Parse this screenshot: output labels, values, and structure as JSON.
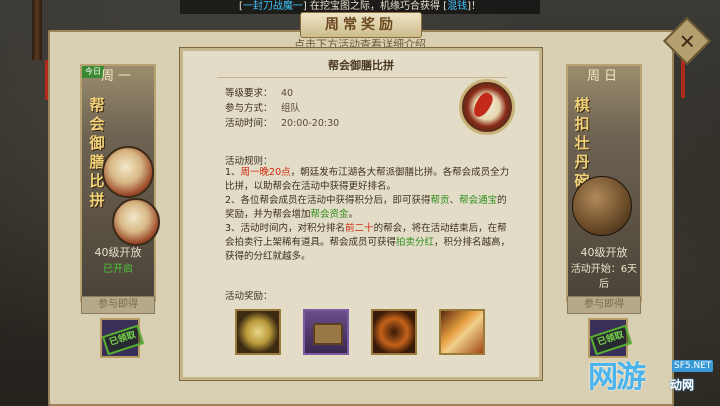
{
  "ticker": {
    "prefix": "[",
    "highlight1": "一封刀战魔一",
    "mid": "] 在挖宝图之际，机缘巧合获得 [",
    "highlight2": "混钱",
    "suffix": "]！"
  },
  "window_title": "周常奖励",
  "main_subtitle": "点击下方活动查看详细介绍",
  "close_icon": "close-icon",
  "cards": {
    "left": {
      "day": "周一",
      "today_tag": "今日",
      "name": "帮会御膳比拼",
      "level": "40级开放",
      "status": "已开启",
      "join": "参与即得",
      "stamp": "已领取"
    },
    "right": {
      "day": "周日",
      "name": "棋扣壮丹碗",
      "level": "40级开放",
      "status": "活动开始：6天后",
      "join": "参与即得",
      "stamp": "已领取"
    }
  },
  "popup": {
    "title": "帮会御膳比拼",
    "level_label": "等级要求：",
    "level_value": "40",
    "mode_label": "参与方式：",
    "mode_value": "组队",
    "time_label": "活动时间：",
    "time_value": "20:00-20:30",
    "rules_head": "活动规则：",
    "rule1_a": "1、",
    "rule1_red": "周一晚20点",
    "rule1_b": "，朝廷发布江湖各大帮派御膳比拼。各帮会成员全力比拼，以助帮会在活动中获得更好排名。",
    "rule2_a": "2、各位帮会成员在活动中获得积分后，即可获得",
    "rule2_g1": "帮贡",
    "rule2_b": "、",
    "rule2_g2": "帮会通宝",
    "rule2_c": "的奖励，并为帮会增加",
    "rule2_g3": "帮会资金",
    "rule2_d": "。",
    "rule3_a": "3、活动时间内，对积分排名",
    "rule3_red": "前二十",
    "rule3_b": "的帮会，将在活动结束后，在帮会拍卖行上架稀有道具。帮会成员可获得",
    "rule3_g": "拍卖分红",
    "rule3_c": "，积分排名越高，获得的分红就越多。",
    "rewards_head": "活动奖励："
  },
  "watermark": {
    "big": "网游",
    "small": "SF5.NET",
    "sub": "动网"
  }
}
